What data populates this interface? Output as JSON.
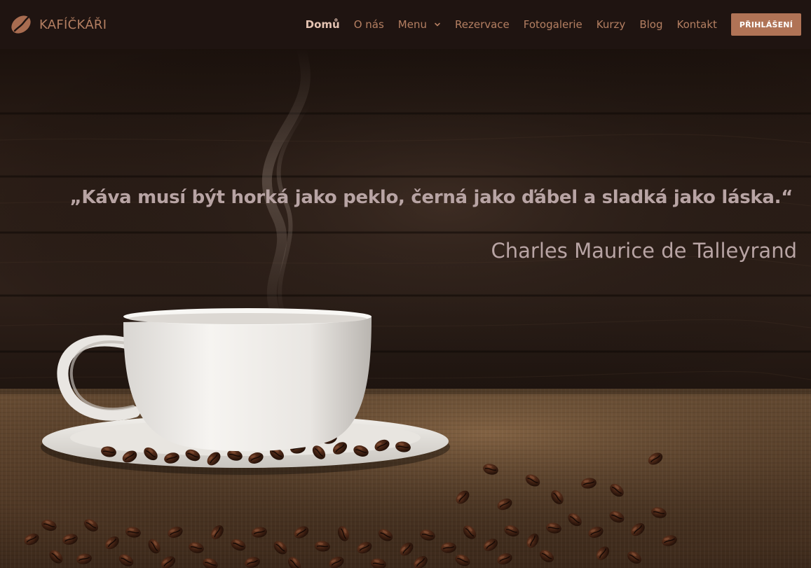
{
  "brand": {
    "name": "KAFÍČKÁŘI",
    "icon": "coffee-bean-icon"
  },
  "nav": {
    "items": [
      {
        "label": "Domů",
        "active": true
      },
      {
        "label": "O nás"
      },
      {
        "label": "Menu",
        "has_dropdown": true,
        "icon": "chevron-down-icon"
      },
      {
        "label": "Rezervace"
      },
      {
        "label": "Fotogalerie"
      },
      {
        "label": "Kurzy"
      },
      {
        "label": "Blog"
      },
      {
        "label": "Kontakt"
      }
    ],
    "login_label": "PŘIHLÁŠENÍ"
  },
  "hero": {
    "quote": "„Káva musí být horká jako peklo, černá jako ďábel a sladká jako láska.“",
    "author": "Charles Maurice de Talleyrand"
  },
  "colors": {
    "navbar_bg": "#1f1411",
    "nav_text": "#b47f62",
    "nav_active": "#e4c3b2",
    "button_bg": "#b07356",
    "quote_text": "#b8a4a4"
  }
}
